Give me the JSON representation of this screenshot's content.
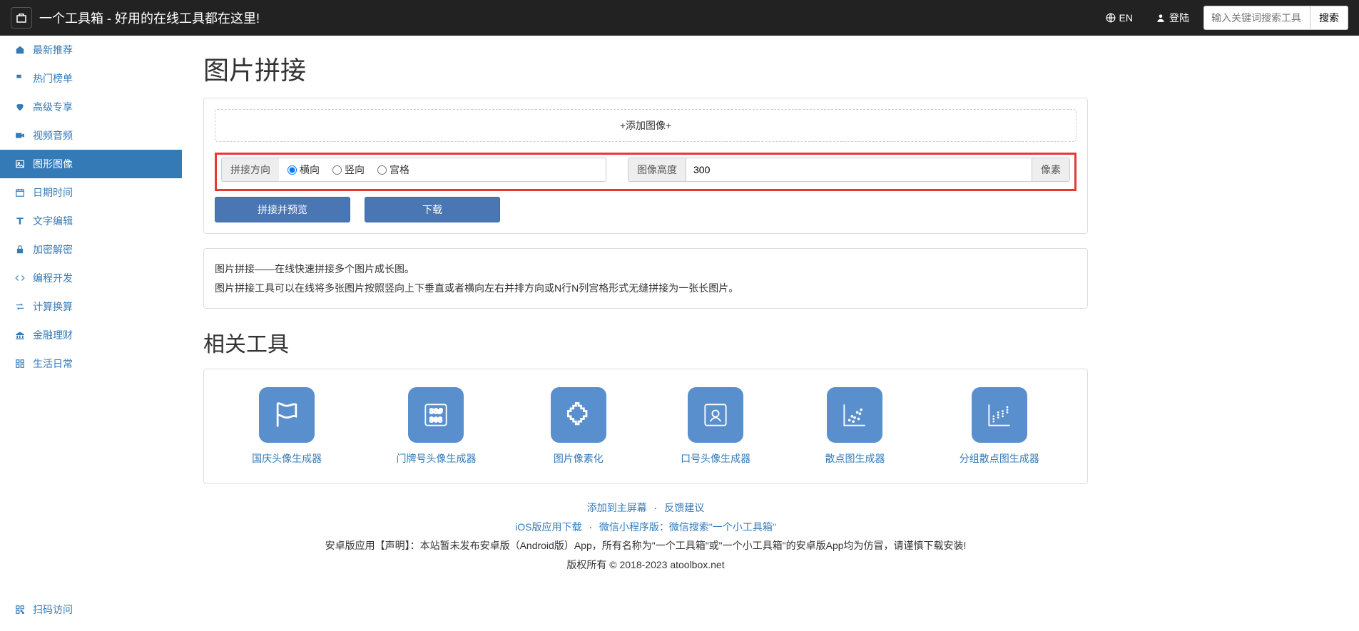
{
  "navbar": {
    "brand": "一个工具箱 - 好用的在线工具都在这里!",
    "lang": "EN",
    "login": "登陆",
    "search_placeholder": "输入关键词搜索工具...",
    "search_btn": "搜索"
  },
  "sidebar": {
    "items": [
      {
        "icon": "home",
        "label": "最新推荐"
      },
      {
        "icon": "flag",
        "label": "热门榜单"
      },
      {
        "icon": "heart",
        "label": "高级专享"
      },
      {
        "icon": "video",
        "label": "视频音频"
      },
      {
        "icon": "image",
        "label": "图形图像"
      },
      {
        "icon": "calendar",
        "label": "日期时间"
      },
      {
        "icon": "text",
        "label": "文字编辑"
      },
      {
        "icon": "lock",
        "label": "加密解密"
      },
      {
        "icon": "code",
        "label": "编程开发"
      },
      {
        "icon": "exchange",
        "label": "计算换算"
      },
      {
        "icon": "money",
        "label": "金融理财"
      },
      {
        "icon": "life",
        "label": "生活日常"
      }
    ],
    "bottom": {
      "icon": "qr",
      "label": "扫码访问"
    }
  },
  "page": {
    "title": "图片拼接",
    "dropzone": "+添加图像+",
    "direction_label": "拼接方向",
    "directions": [
      "横向",
      "竖向",
      "宫格"
    ],
    "height_label": "图像高度",
    "height_value": "300",
    "height_unit": "像素",
    "preview_btn": "拼接并预览",
    "download_btn": "下载",
    "desc1": "图片拼接——在线快速拼接多个图片成长图。",
    "desc2": "图片拼接工具可以在线将多张图片按照竖向上下垂直或者横向左右并排方向或N行N列宫格形式无缝拼接为一张长图片。"
  },
  "related": {
    "title": "相关工具",
    "tools": [
      {
        "label": "国庆头像生成器"
      },
      {
        "label": "门牌号头像生成器"
      },
      {
        "label": "图片像素化"
      },
      {
        "label": "口号头像生成器"
      },
      {
        "label": "散点图生成器"
      },
      {
        "label": "分组散点图生成器"
      }
    ]
  },
  "footer": {
    "links1": [
      "添加到主屏幕",
      "反馈建议"
    ],
    "links2_a": "iOS版应用下载",
    "links2_b": "微信小程序版：微信搜索\"一个小工具箱\"",
    "disclaimer": "安卓版应用【声明】：本站暂未发布安卓版（Android版）App，所有名称为\"一个工具箱\"或\"一个小工具箱\"的安卓版App均为仿冒，请谨慎下载安装!",
    "copyright": "版权所有 © 2018-2023 atoolbox.net"
  }
}
